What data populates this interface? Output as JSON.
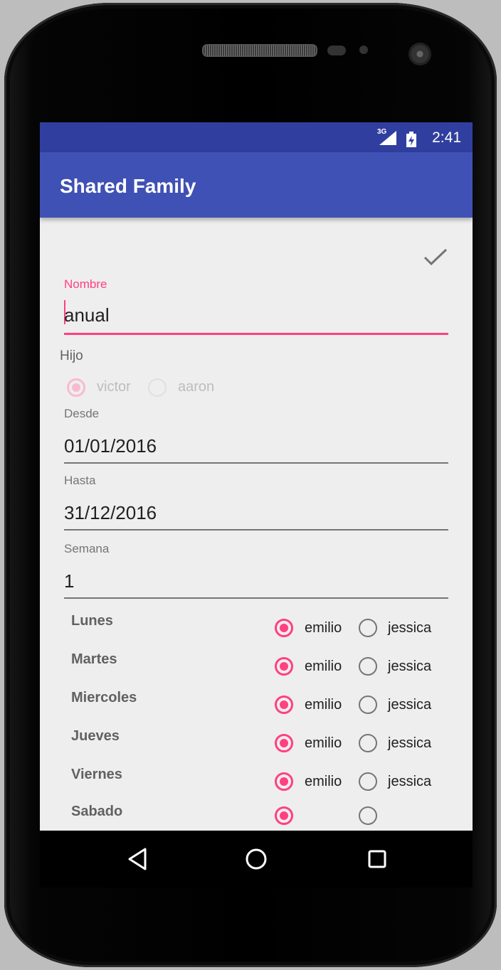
{
  "status_bar": {
    "network": "3G",
    "time": "2:41"
  },
  "app_bar": {
    "title": "Shared Family"
  },
  "form": {
    "nombre": {
      "label": "Nombre",
      "value": "anual"
    },
    "hijo": {
      "label": "Hijo",
      "options": [
        "victor",
        "aaron"
      ],
      "selected": "victor"
    },
    "desde": {
      "label": "Desde",
      "value": "01/01/2016"
    },
    "hasta": {
      "label": "Hasta",
      "value": "31/12/2016"
    },
    "semana": {
      "label": "Semana",
      "value": "1"
    }
  },
  "schedule": {
    "parents": [
      "emilio",
      "jessica"
    ],
    "days": [
      {
        "day": "Lunes",
        "selected": "emilio"
      },
      {
        "day": "Martes",
        "selected": "emilio"
      },
      {
        "day": "Miercoles",
        "selected": "emilio"
      },
      {
        "day": "Jueves",
        "selected": "emilio"
      },
      {
        "day": "Viernes",
        "selected": "emilio"
      },
      {
        "day": "Sabado",
        "selected": "emilio"
      }
    ]
  },
  "icons": {
    "save": "check-icon",
    "back": "back-triangle-icon",
    "home": "home-circle-icon",
    "recents": "recents-square-icon"
  },
  "colors": {
    "primary": "#3f51b5",
    "primary_dark": "#303f9f",
    "accent": "#ff4081",
    "background": "#eeeeee"
  }
}
